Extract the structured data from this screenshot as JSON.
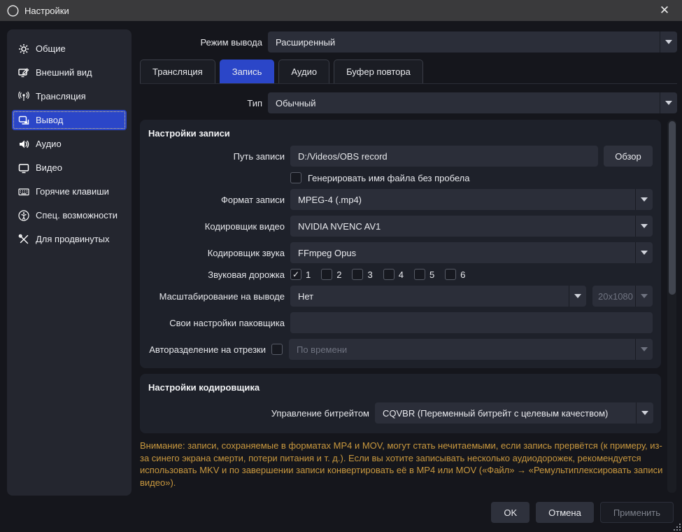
{
  "window": {
    "title": "Настройки",
    "close_glyph": "✕"
  },
  "sidebar": {
    "items": [
      {
        "label": "Общие",
        "icon": "gear-icon",
        "selected": false
      },
      {
        "label": "Внешний вид",
        "icon": "appearance-icon",
        "selected": false
      },
      {
        "label": "Трансляция",
        "icon": "broadcast-icon",
        "selected": false
      },
      {
        "label": "Вывод",
        "icon": "output-icon",
        "selected": true
      },
      {
        "label": "Аудио",
        "icon": "speaker-icon",
        "selected": false
      },
      {
        "label": "Видео",
        "icon": "monitor-icon",
        "selected": false
      },
      {
        "label": "Горячие клавиши",
        "icon": "keyboard-icon",
        "selected": false
      },
      {
        "label": "Спец. возможности",
        "icon": "accessibility-icon",
        "selected": false
      },
      {
        "label": "Для продвинутых",
        "icon": "tools-icon",
        "selected": false
      }
    ]
  },
  "output_mode": {
    "label": "Режим вывода",
    "value": "Расширенный"
  },
  "tabs": [
    {
      "label": "Трансляция",
      "active": false
    },
    {
      "label": "Запись",
      "active": true
    },
    {
      "label": "Аудио",
      "active": false
    },
    {
      "label": "Буфер повтора",
      "active": false
    }
  ],
  "type_row": {
    "label": "Тип",
    "value": "Обычный"
  },
  "recording": {
    "title": "Настройки записи",
    "path": {
      "label": "Путь записи",
      "value": "D:/Videos/OBS record",
      "browse_label": "Обзор"
    },
    "nospace": {
      "label": "Генерировать имя файла без пробела",
      "checked": false
    },
    "format": {
      "label": "Формат записи",
      "value": "MPEG-4 (.mp4)"
    },
    "video_encoder": {
      "label": "Кодировщик видео",
      "value": "NVIDIA NVENC AV1"
    },
    "audio_encoder": {
      "label": "Кодировщик звука",
      "value": "FFmpeg Opus"
    },
    "tracks": {
      "label": "Звуковая дорожка",
      "options": [
        {
          "label": "1",
          "checked": true
        },
        {
          "label": "2",
          "checked": false
        },
        {
          "label": "3",
          "checked": false
        },
        {
          "label": "4",
          "checked": false
        },
        {
          "label": "5",
          "checked": false
        },
        {
          "label": "6",
          "checked": false
        }
      ]
    },
    "rescale": {
      "label": "Масштабирование на выводе",
      "value": "Нет",
      "resolution_value": "20x1080",
      "resolution_disabled": true
    },
    "muxer": {
      "label": "Свои настройки паковщика",
      "value": ""
    },
    "autosplit": {
      "label": "Авторазделение на отрезки",
      "checked": false,
      "value": "По времени",
      "disabled": true
    }
  },
  "encoder": {
    "title": "Настройки кодировщика",
    "bitrate": {
      "label": "Управление битрейтом",
      "value": "CQVBR (Переменный битрейт с целевым качеством)"
    }
  },
  "warning_text": "Внимание: записи, сохраняемые в форматах MP4 и MOV, могут стать нечитаемыми, если запись прервётся (к примеру, из-за синего экрана смерти, потери питания и т. д.). Если вы хотите записывать несколько аудиодорожек, рекомендуется использовать MKV и по завершении записи конвертировать её в MP4 или MOV («Файл» → «Ремультиплексировать записи видео»).",
  "footer": {
    "ok": "OK",
    "cancel": "Отмена",
    "apply": "Применить",
    "apply_disabled": true
  },
  "colors": {
    "accent_blue": "#2b46c8",
    "warning_orange": "#c9983e",
    "panel_bg": "#1e212a",
    "input_bg": "#2b2e39",
    "titlebar_bg": "#3a3a3c"
  }
}
